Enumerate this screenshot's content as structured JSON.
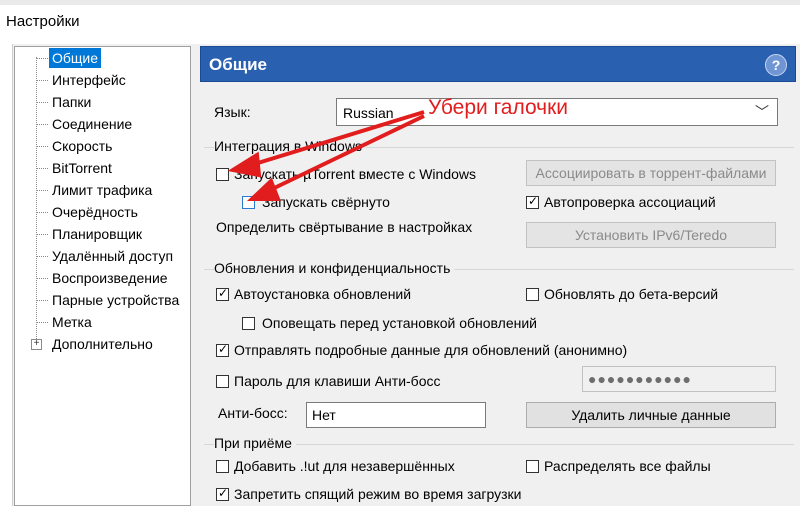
{
  "window": {
    "title": "Настройки"
  },
  "sidebar": {
    "items": [
      {
        "label": "Общие",
        "selected": true
      },
      {
        "label": "Интерфейс"
      },
      {
        "label": "Папки"
      },
      {
        "label": "Соединение"
      },
      {
        "label": "Скорость"
      },
      {
        "label": "BitTorrent"
      },
      {
        "label": "Лимит трафика"
      },
      {
        "label": "Очерёдность"
      },
      {
        "label": "Планировщик"
      },
      {
        "label": "Удалённый доступ"
      },
      {
        "label": "Воспроизведение"
      },
      {
        "label": "Парные устройства"
      },
      {
        "label": "Метка"
      },
      {
        "label": "Дополнительно",
        "expandable": true
      }
    ],
    "expander_symbol": "+"
  },
  "header": {
    "title": "Общие",
    "help_symbol": "?"
  },
  "language": {
    "label": "Язык:",
    "value": "Russian"
  },
  "annotation": {
    "text": "Убери галочки",
    "color": "#e11d1d"
  },
  "integration": {
    "title": "Интеграция в Windows",
    "start_with_windows": {
      "label": "Запускать µTorrent вместе с Windows",
      "checked": false
    },
    "start_minimized": {
      "label": "Запускать свёрнуто",
      "checked": false
    },
    "minimize_settings_text": "Определить свёртывание в настройках",
    "assoc_button": "Ассоциировать в торрент-файлами",
    "auto_check_assoc": {
      "label": "Автопроверка ассоциаций",
      "checked": true
    },
    "ipv6_button": "Установить IPv6/Teredo"
  },
  "updates": {
    "title": "Обновления и конфиденциальность",
    "auto_install": {
      "label": "Автоустановка обновлений",
      "checked": true
    },
    "beta": {
      "label": "Обновлять до бета-версий",
      "checked": false
    },
    "notify_before": {
      "label": "Оповещать перед установкой обновлений",
      "checked": false
    },
    "send_details": {
      "label": "Отправлять подробные данные для обновлений (анонимно)",
      "checked": true
    },
    "boss_password": {
      "label": "Пароль для клавиши Анти-босс",
      "checked": false
    },
    "password_value": "●●●●●●●●●●●",
    "antiboss_label": "Анти-босс:",
    "antiboss_value": "Нет",
    "delete_data_button": "Удалить личные данные"
  },
  "receive": {
    "title": "При приёме",
    "add_ut": {
      "label": "Добавить .!ut для незавершённых",
      "checked": false
    },
    "distribute": {
      "label": "Распределять все файлы",
      "checked": false
    },
    "prevent_sleep": {
      "label": "Запретить спящий режим во время загрузки",
      "checked": true
    }
  },
  "icons": {
    "check": "✓",
    "chevron": "﹀"
  }
}
